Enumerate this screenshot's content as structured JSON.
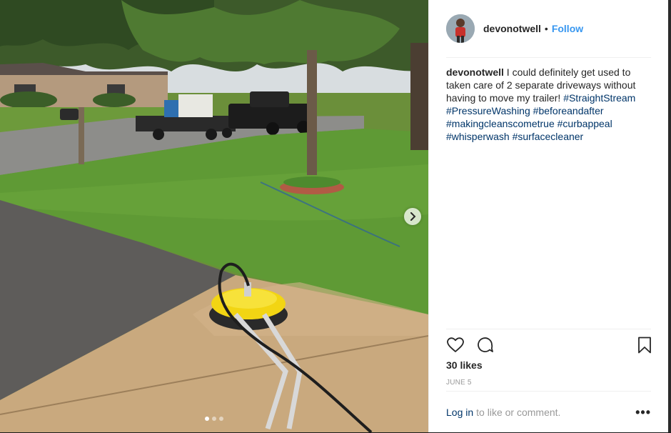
{
  "post": {
    "username": "devonotwell",
    "separator": "•",
    "follow_label": "Follow",
    "caption": {
      "username": "devonotwell",
      "text": "I could definitely get used to taken care of 2 separate driveways without having to move my trailer!",
      "hashtags": [
        "#StraightStream",
        "#PressureWashing",
        "#beforeandafter",
        "#makingcleanscometrue",
        "#curbappeal",
        "#whisperwash",
        "#surfacecleaner"
      ]
    },
    "likes": "30 likes",
    "date": "JUNE 5",
    "login_label": "Log in",
    "login_suffix": "to like or comment.",
    "more_label": "•••"
  },
  "carousel": {
    "slide_count": 3,
    "active_index": 0
  },
  "colors": {
    "link": "#003569",
    "follow": "#3897f0",
    "muted": "#999999",
    "text": "#262626"
  },
  "icons": [
    "heart-icon",
    "comment-icon",
    "bookmark-icon",
    "chevron-right-icon",
    "more-options-icon"
  ]
}
